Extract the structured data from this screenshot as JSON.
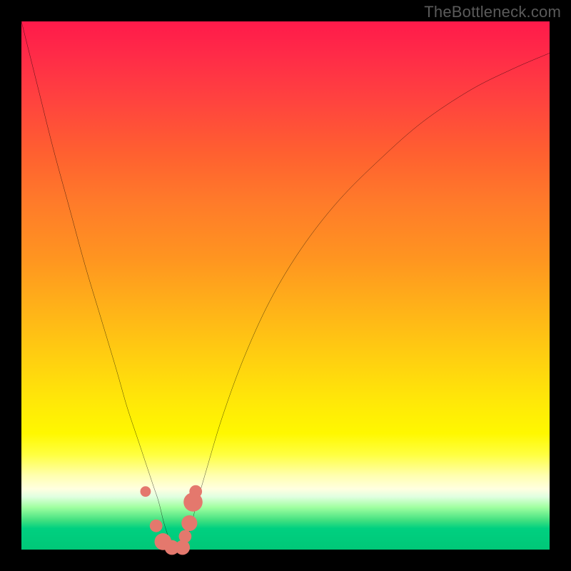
{
  "watermark": "TheBottleneck.com",
  "colors": {
    "frame": "#000000",
    "curve_stroke": "#000000",
    "marker_fill": "#e4786d",
    "gradient_top": "#ff1a4a",
    "gradient_bottom": "#00c878"
  },
  "chart_data": {
    "type": "line",
    "title": "",
    "xlabel": "",
    "ylabel": "",
    "xlim": [
      0,
      100
    ],
    "ylim": [
      0,
      100
    ],
    "grid": false,
    "legend": false,
    "series": [
      {
        "name": "bottleneck-curve",
        "x": [
          0,
          3,
          6,
          9,
          12,
          15,
          18,
          20,
          22,
          24,
          25,
          26,
          27,
          28,
          29,
          30,
          31,
          32,
          33,
          35,
          38,
          42,
          47,
          53,
          60,
          68,
          76,
          85,
          93,
          100
        ],
        "y": [
          100,
          88,
          76,
          65,
          54,
          44,
          34,
          27,
          21,
          15,
          12,
          9,
          5,
          2,
          0,
          0,
          1,
          4,
          8,
          15,
          25,
          36,
          47,
          57,
          66,
          74,
          81,
          87,
          91,
          94
        ]
      }
    ],
    "markers": [
      {
        "x": 23.5,
        "y": 11.0,
        "r": 1.0
      },
      {
        "x": 25.5,
        "y": 4.5,
        "r": 1.2
      },
      {
        "x": 26.8,
        "y": 1.5,
        "r": 1.6
      },
      {
        "x": 28.5,
        "y": 0.4,
        "r": 1.4
      },
      {
        "x": 30.5,
        "y": 0.4,
        "r": 1.4
      },
      {
        "x": 31.0,
        "y": 2.5,
        "r": 1.2
      },
      {
        "x": 31.8,
        "y": 5.0,
        "r": 1.5
      },
      {
        "x": 32.5,
        "y": 9.0,
        "r": 1.8
      },
      {
        "x": 33.0,
        "y": 11.0,
        "r": 1.2
      }
    ]
  }
}
